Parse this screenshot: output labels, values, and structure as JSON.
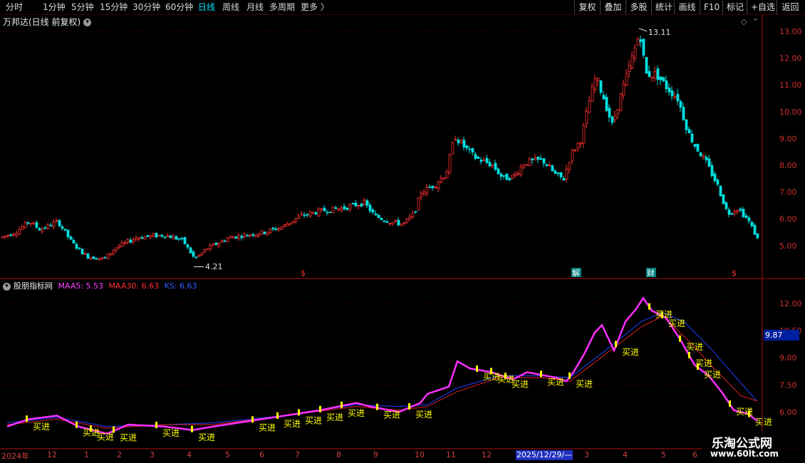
{
  "toolbar": {
    "periods": [
      "分时",
      "1分钟",
      "5分钟",
      "15分钟",
      "30分钟",
      "60分钟",
      "日线",
      "周线",
      "月线",
      "多周期",
      "更多 〉"
    ],
    "active_period": "日线",
    "right_buttons": [
      "复权",
      "叠加",
      "多股",
      "统计",
      "画线",
      "F10",
      "标记",
      "+自选",
      "返回"
    ]
  },
  "main_chart": {
    "title": "万邦达(日线 前复权)",
    "high_label": "13.11",
    "low_label": "4.21",
    "y_ticks": [
      "13.00",
      "12.00",
      "11.00",
      "10.00",
      "9.00",
      "8.00",
      "7.00",
      "6.00",
      "5.00"
    ],
    "event_markers": [
      "$",
      "解",
      "财",
      "$"
    ]
  },
  "indicator": {
    "name": "股朋指标网",
    "ma5_label": "MAA5: 5.53",
    "ma30_label": "MAA30: 6.63",
    "ks_label": "KS: 6.63",
    "y_ticks": [
      "12.00",
      "10.50",
      "9.00",
      "7.50",
      "6.00"
    ],
    "current_value": "9.87",
    "signal_text": "买进"
  },
  "date_axis": {
    "ticks": [
      "2024年",
      "12",
      "1",
      "2",
      "3",
      "4",
      "5",
      "6",
      "7",
      "8",
      "9",
      "10",
      "11",
      "12",
      "3",
      "4",
      "5",
      "6"
    ],
    "highlight": "2025/12/29/—"
  },
  "watermark": {
    "title": "乐淘公式网",
    "url": "www.60lt.com"
  },
  "colors": {
    "up": "#ff3030",
    "down": "#00e0e0",
    "ma5": "#ff30ff",
    "ma30": "#e02020",
    "ks": "#2040ff",
    "signal": "#ffff00"
  },
  "chart_data": {
    "type": "candlestick",
    "price_anchors": [
      [
        0,
        5.3
      ],
      [
        20,
        5.5
      ],
      [
        40,
        5.9
      ],
      [
        55,
        5.6
      ],
      [
        80,
        5.9
      ],
      [
        100,
        5.1
      ],
      [
        120,
        4.6
      ],
      [
        145,
        4.5
      ],
      [
        160,
        4.9
      ],
      [
        190,
        5.3
      ],
      [
        230,
        5.4
      ],
      [
        255,
        5.2
      ],
      [
        272,
        4.5
      ],
      [
        290,
        4.9
      ],
      [
        320,
        5.3
      ],
      [
        345,
        5.4
      ],
      [
        370,
        5.5
      ],
      [
        395,
        5.7
      ],
      [
        420,
        6.1
      ],
      [
        450,
        6.3
      ],
      [
        480,
        6.4
      ],
      [
        510,
        6.6
      ],
      [
        525,
        6.1
      ],
      [
        545,
        5.9
      ],
      [
        565,
        5.8
      ],
      [
        580,
        6.2
      ],
      [
        590,
        7.0
      ],
      [
        610,
        7.3
      ],
      [
        625,
        7.7
      ],
      [
        637,
        9.1
      ],
      [
        650,
        8.7
      ],
      [
        665,
        8.3
      ],
      [
        690,
        8.0
      ],
      [
        705,
        7.5
      ],
      [
        720,
        7.6
      ],
      [
        735,
        8.1
      ],
      [
        760,
        8.2
      ],
      [
        780,
        7.6
      ],
      [
        790,
        7.5
      ],
      [
        800,
        8.4
      ],
      [
        815,
        9.0
      ],
      [
        825,
        10.3
      ],
      [
        835,
        11.3
      ],
      [
        845,
        10.6
      ],
      [
        858,
        9.5
      ],
      [
        870,
        10.6
      ],
      [
        885,
        11.9
      ],
      [
        897,
        13.0
      ],
      [
        905,
        11.4
      ],
      [
        920,
        11.4
      ],
      [
        935,
        10.9
      ],
      [
        950,
        10.5
      ],
      [
        965,
        9.2
      ],
      [
        975,
        8.7
      ],
      [
        990,
        8.1
      ],
      [
        1005,
        7.3
      ],
      [
        1020,
        6.2
      ],
      [
        1035,
        6.4
      ],
      [
        1050,
        5.9
      ],
      [
        1063,
        5.2
      ]
    ],
    "high_point": {
      "x": 897,
      "value": 13.11
    },
    "low_point": {
      "x": 272,
      "value": 4.21
    },
    "indicator_series": {
      "ma5": [
        [
          10,
          5.2
        ],
        [
          40,
          5.6
        ],
        [
          80,
          5.8
        ],
        [
          110,
          5.2
        ],
        [
          150,
          4.8
        ],
        [
          180,
          5.3
        ],
        [
          230,
          5.2
        ],
        [
          270,
          5.0
        ],
        [
          300,
          5.2
        ],
        [
          350,
          5.5
        ],
        [
          400,
          5.8
        ],
        [
          450,
          6.1
        ],
        [
          500,
          6.5
        ],
        [
          520,
          6.3
        ],
        [
          560,
          6.0
        ],
        [
          590,
          6.5
        ],
        [
          600,
          7.0
        ],
        [
          630,
          7.4
        ],
        [
          642,
          8.8
        ],
        [
          660,
          8.4
        ],
        [
          690,
          8.2
        ],
        [
          720,
          7.8
        ],
        [
          740,
          8.2
        ],
        [
          780,
          7.9
        ],
        [
          795,
          7.7
        ],
        [
          805,
          8.2
        ],
        [
          820,
          9.2
        ],
        [
          835,
          10.4
        ],
        [
          845,
          10.8
        ],
        [
          862,
          9.4
        ],
        [
          878,
          11.0
        ],
        [
          893,
          11.7
        ],
        [
          903,
          12.3
        ],
        [
          915,
          11.6
        ],
        [
          935,
          11.2
        ],
        [
          955,
          10.0
        ],
        [
          975,
          8.6
        ],
        [
          995,
          8.0
        ],
        [
          1015,
          7.0
        ],
        [
          1030,
          6.1
        ],
        [
          1050,
          5.9
        ],
        [
          1063,
          5.5
        ]
      ],
      "ma30": [
        [
          10,
          5.3
        ],
        [
          80,
          5.6
        ],
        [
          150,
          5.1
        ],
        [
          230,
          5.3
        ],
        [
          300,
          5.3
        ],
        [
          400,
          5.8
        ],
        [
          500,
          6.3
        ],
        [
          560,
          6.1
        ],
        [
          600,
          6.3
        ],
        [
          640,
          7.1
        ],
        [
          700,
          7.9
        ],
        [
          760,
          7.9
        ],
        [
          800,
          7.7
        ],
        [
          850,
          9.2
        ],
        [
          900,
          10.7
        ],
        [
          930,
          11.3
        ],
        [
          965,
          10.0
        ],
        [
          1000,
          8.5
        ],
        [
          1040,
          6.9
        ],
        [
          1063,
          6.6
        ]
      ],
      "ks": [
        [
          10,
          5.4
        ],
        [
          80,
          5.7
        ],
        [
          150,
          5.2
        ],
        [
          230,
          5.3
        ],
        [
          300,
          5.4
        ],
        [
          400,
          5.8
        ],
        [
          500,
          6.4
        ],
        [
          560,
          6.3
        ],
        [
          600,
          6.4
        ],
        [
          640,
          7.3
        ],
        [
          700,
          8.0
        ],
        [
          760,
          8.0
        ],
        [
          800,
          7.9
        ],
        [
          850,
          9.4
        ],
        [
          900,
          11.0
        ],
        [
          930,
          11.5
        ],
        [
          960,
          11.0
        ],
        [
          1000,
          9.4
        ],
        [
          1040,
          7.6
        ],
        [
          1063,
          6.6
        ]
      ]
    },
    "signal_x": [
      38,
      108,
      128,
      160,
      220,
      270,
      355,
      390,
      420,
      450,
      480,
      530,
      575,
      670,
      690,
      710,
      760,
      800,
      865,
      912,
      930,
      955,
      968,
      980,
      1025,
      1052
    ]
  }
}
